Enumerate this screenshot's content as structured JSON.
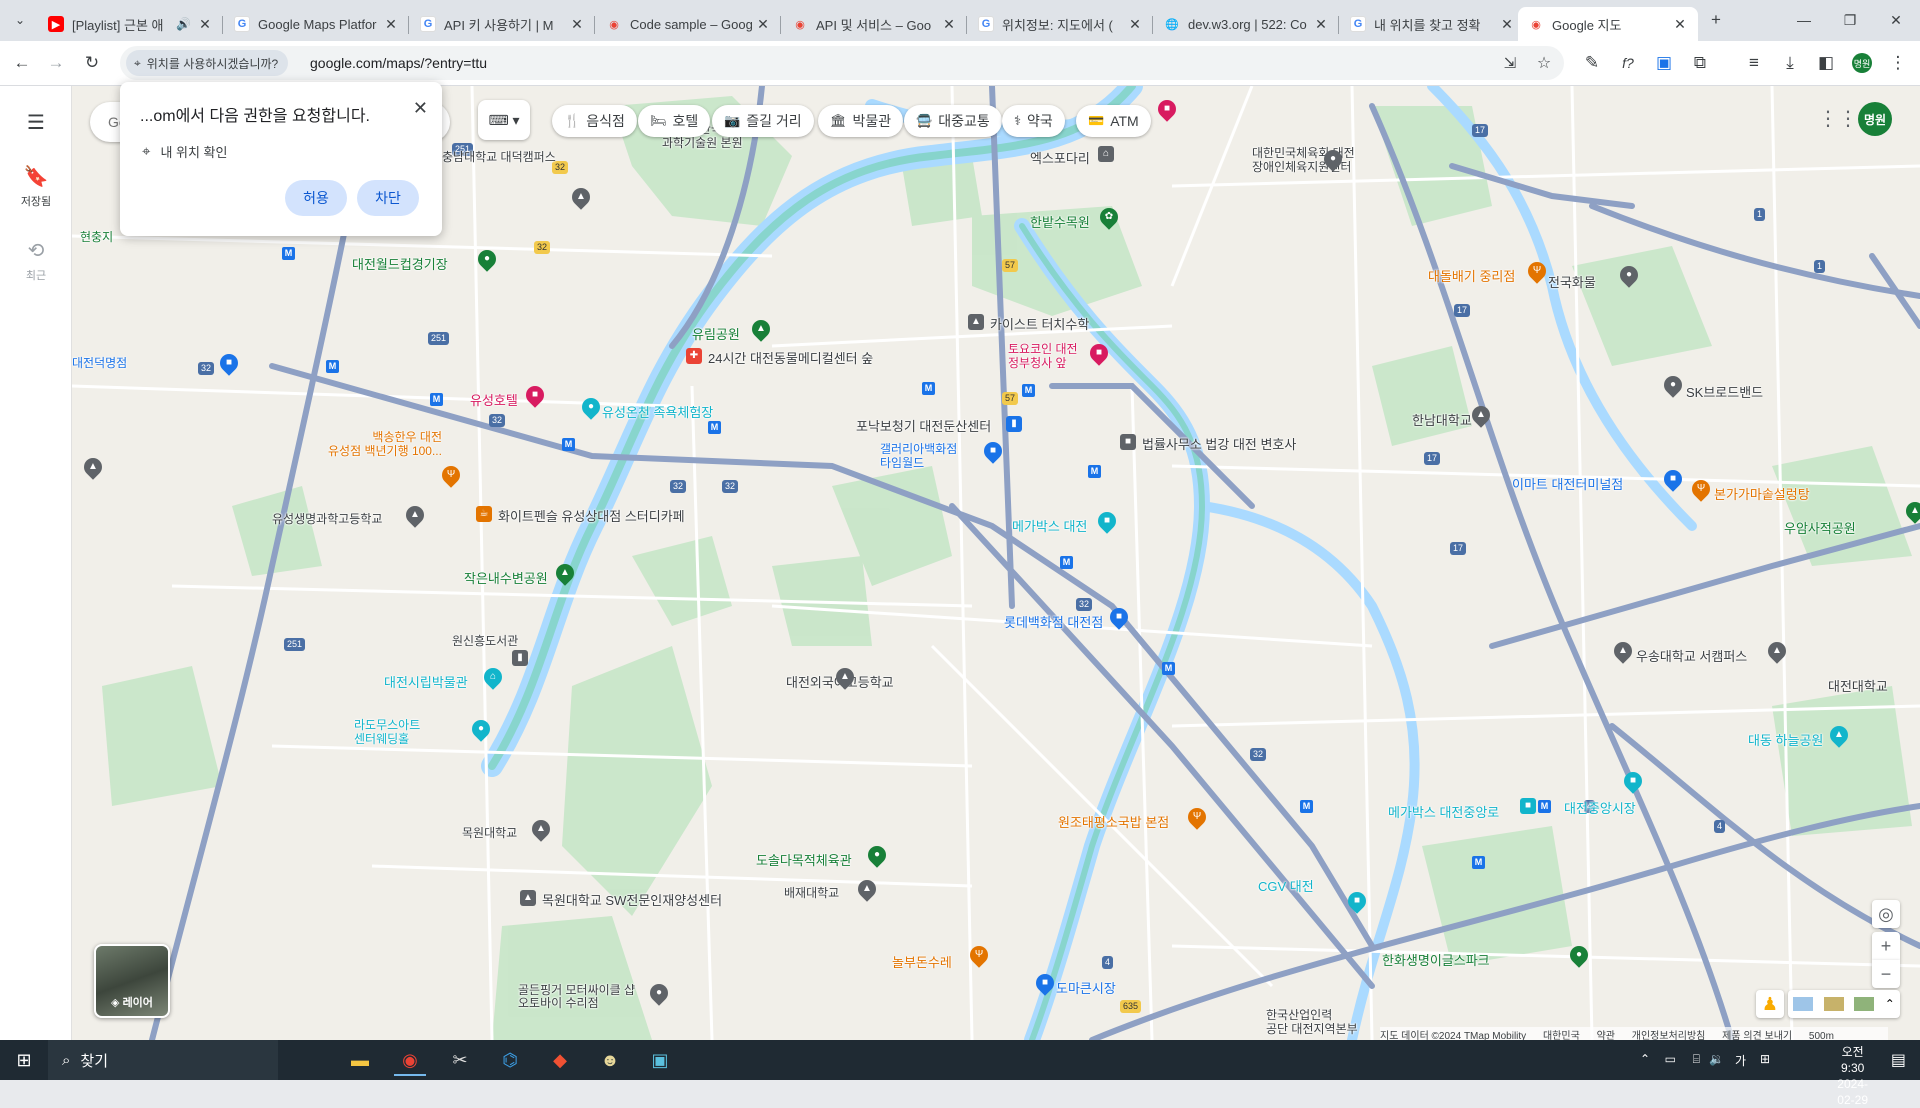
{
  "browser": {
    "tabs": [
      {
        "title": "[Playlist] 근본 애",
        "icon": "youtube-icon",
        "audio": true
      },
      {
        "title": "Google Maps Platfor",
        "icon": "google-icon"
      },
      {
        "title": "API 키 사용하기 | M",
        "icon": "google-icon"
      },
      {
        "title": "Code sample – Goog",
        "icon": "maps-icon"
      },
      {
        "title": "API 및 서비스 – Goo",
        "icon": "maps-icon"
      },
      {
        "title": "위치정보: 지도에서 (",
        "icon": "google-icon"
      },
      {
        "title": "dev.w3.org | 522: Co",
        "icon": "globe-icon"
      },
      {
        "title": "내 위치를 찾고 정확",
        "icon": "google-icon"
      },
      {
        "title": "Google 지도",
        "icon": "maps-icon",
        "active": true
      }
    ],
    "new_tab": "+",
    "permission_chip": "위치를 사용하시겠습니까?",
    "url": "google.com/maps/?entry=ttu",
    "profile_initials": "명원"
  },
  "rail": {
    "saved_label": "저장됨",
    "recent_label": "최근"
  },
  "search": {
    "placeholder": "Google 지도 검색"
  },
  "categories": [
    "음식점",
    "호텔",
    "즐길 거리",
    "박물관",
    "대중교통",
    "약국",
    "ATM"
  ],
  "permission_popup": {
    "title": "...om에서 다음 권한을 요청합니다.",
    "item": "내 위치 확인",
    "allow": "허용",
    "block": "차단"
  },
  "account_initials": "명원",
  "layers_label": "레이어",
  "footer": {
    "attribution": "지도 데이터 ©2024 TMap Mobility",
    "country": "대한민국",
    "terms": "약관",
    "privacy": "개인정보처리방침",
    "feedback": "제품 의견 보내기",
    "scale": "500m"
  },
  "google_logo": "Google",
  "map_labels": {
    "kaist": "KAIST 한국\n과학기술원 본원",
    "expo": "엑스포다리",
    "hanbat_arboretum": "한밭수목원",
    "touch_math": "카이스트 터치수학",
    "toyoko": "토요코인 대전\n정부청사 앞",
    "yurim_park": "유림공원",
    "animal_center": "24시간 대전동물메디컬센터 숲",
    "posco": "포낙보청기 대전둔산센터",
    "galleria": "갤러리아백화점\n타임월드",
    "law_office": "법률사무소 법강 대전 변호사",
    "megabox_daejeon": "메가박스 대전",
    "yuseong_hotel": "유성호텔",
    "yuseong_spa": "유성온천 족욕체험장",
    "beaksung": "백송한우 대전\n유성점 백년기행 100...",
    "whitepen": "화이트펜슬 유성상대점 스터디카페",
    "yuseong_science": "유성생명과학고등학교",
    "small_park": "작은내수변공원",
    "wonsin_library": "원신흥도서관",
    "museum": "대전시립박물관",
    "lotte_dept": "롯데백화점 대전점",
    "foreign_lang": "대전외국어고등학교",
    "ladomus": "라도무스아트\n센터웨딩홀",
    "mokwon": "목원대학교",
    "mokwon_sw": "목원대학교 SW전문인재양성센터",
    "dosol": "도솔다목적체육관",
    "baejae": "배재대학교",
    "wonjo": "원조태평소국밥 본점",
    "nolbu": "놀부돈수레",
    "domasijang": "도마큰시장",
    "cgv": "CGV 대전",
    "hanwha": "한화생명이글스파크",
    "megabox_jungang": "메가박스 대전중앙로",
    "jungang_market": "대전중앙시장",
    "daedong_sky": "대동 하늘공원",
    "woosong_seo": "우송대학교 서캠퍼스",
    "daejeon_univ": "대전대학교",
    "emart": "이마트 대전터미널점",
    "bonga": "본가가마솥설렁탕",
    "uam_park": "우암사적공원",
    "hannam": "한남대학교",
    "sk_broadband": "SK브로드밴드",
    "daedolbaegi": "대돌배기 중리점",
    "jeonguk": "전국화물",
    "culture_center": "대한민국체육회 대전\n장애인체육지원센터",
    "worldcup": "대전월드컵경기장",
    "hyunchungji": "현충지",
    "daejeon_deok": "대전덕명점",
    "chungnam_univ": "충남대학교 대덕캠퍼스",
    "goldfinger": "골든핑거 모터싸이클 샵\n오토바이 수리점",
    "industry": "한국산업인력\n공단 대전지역본부"
  }
}
